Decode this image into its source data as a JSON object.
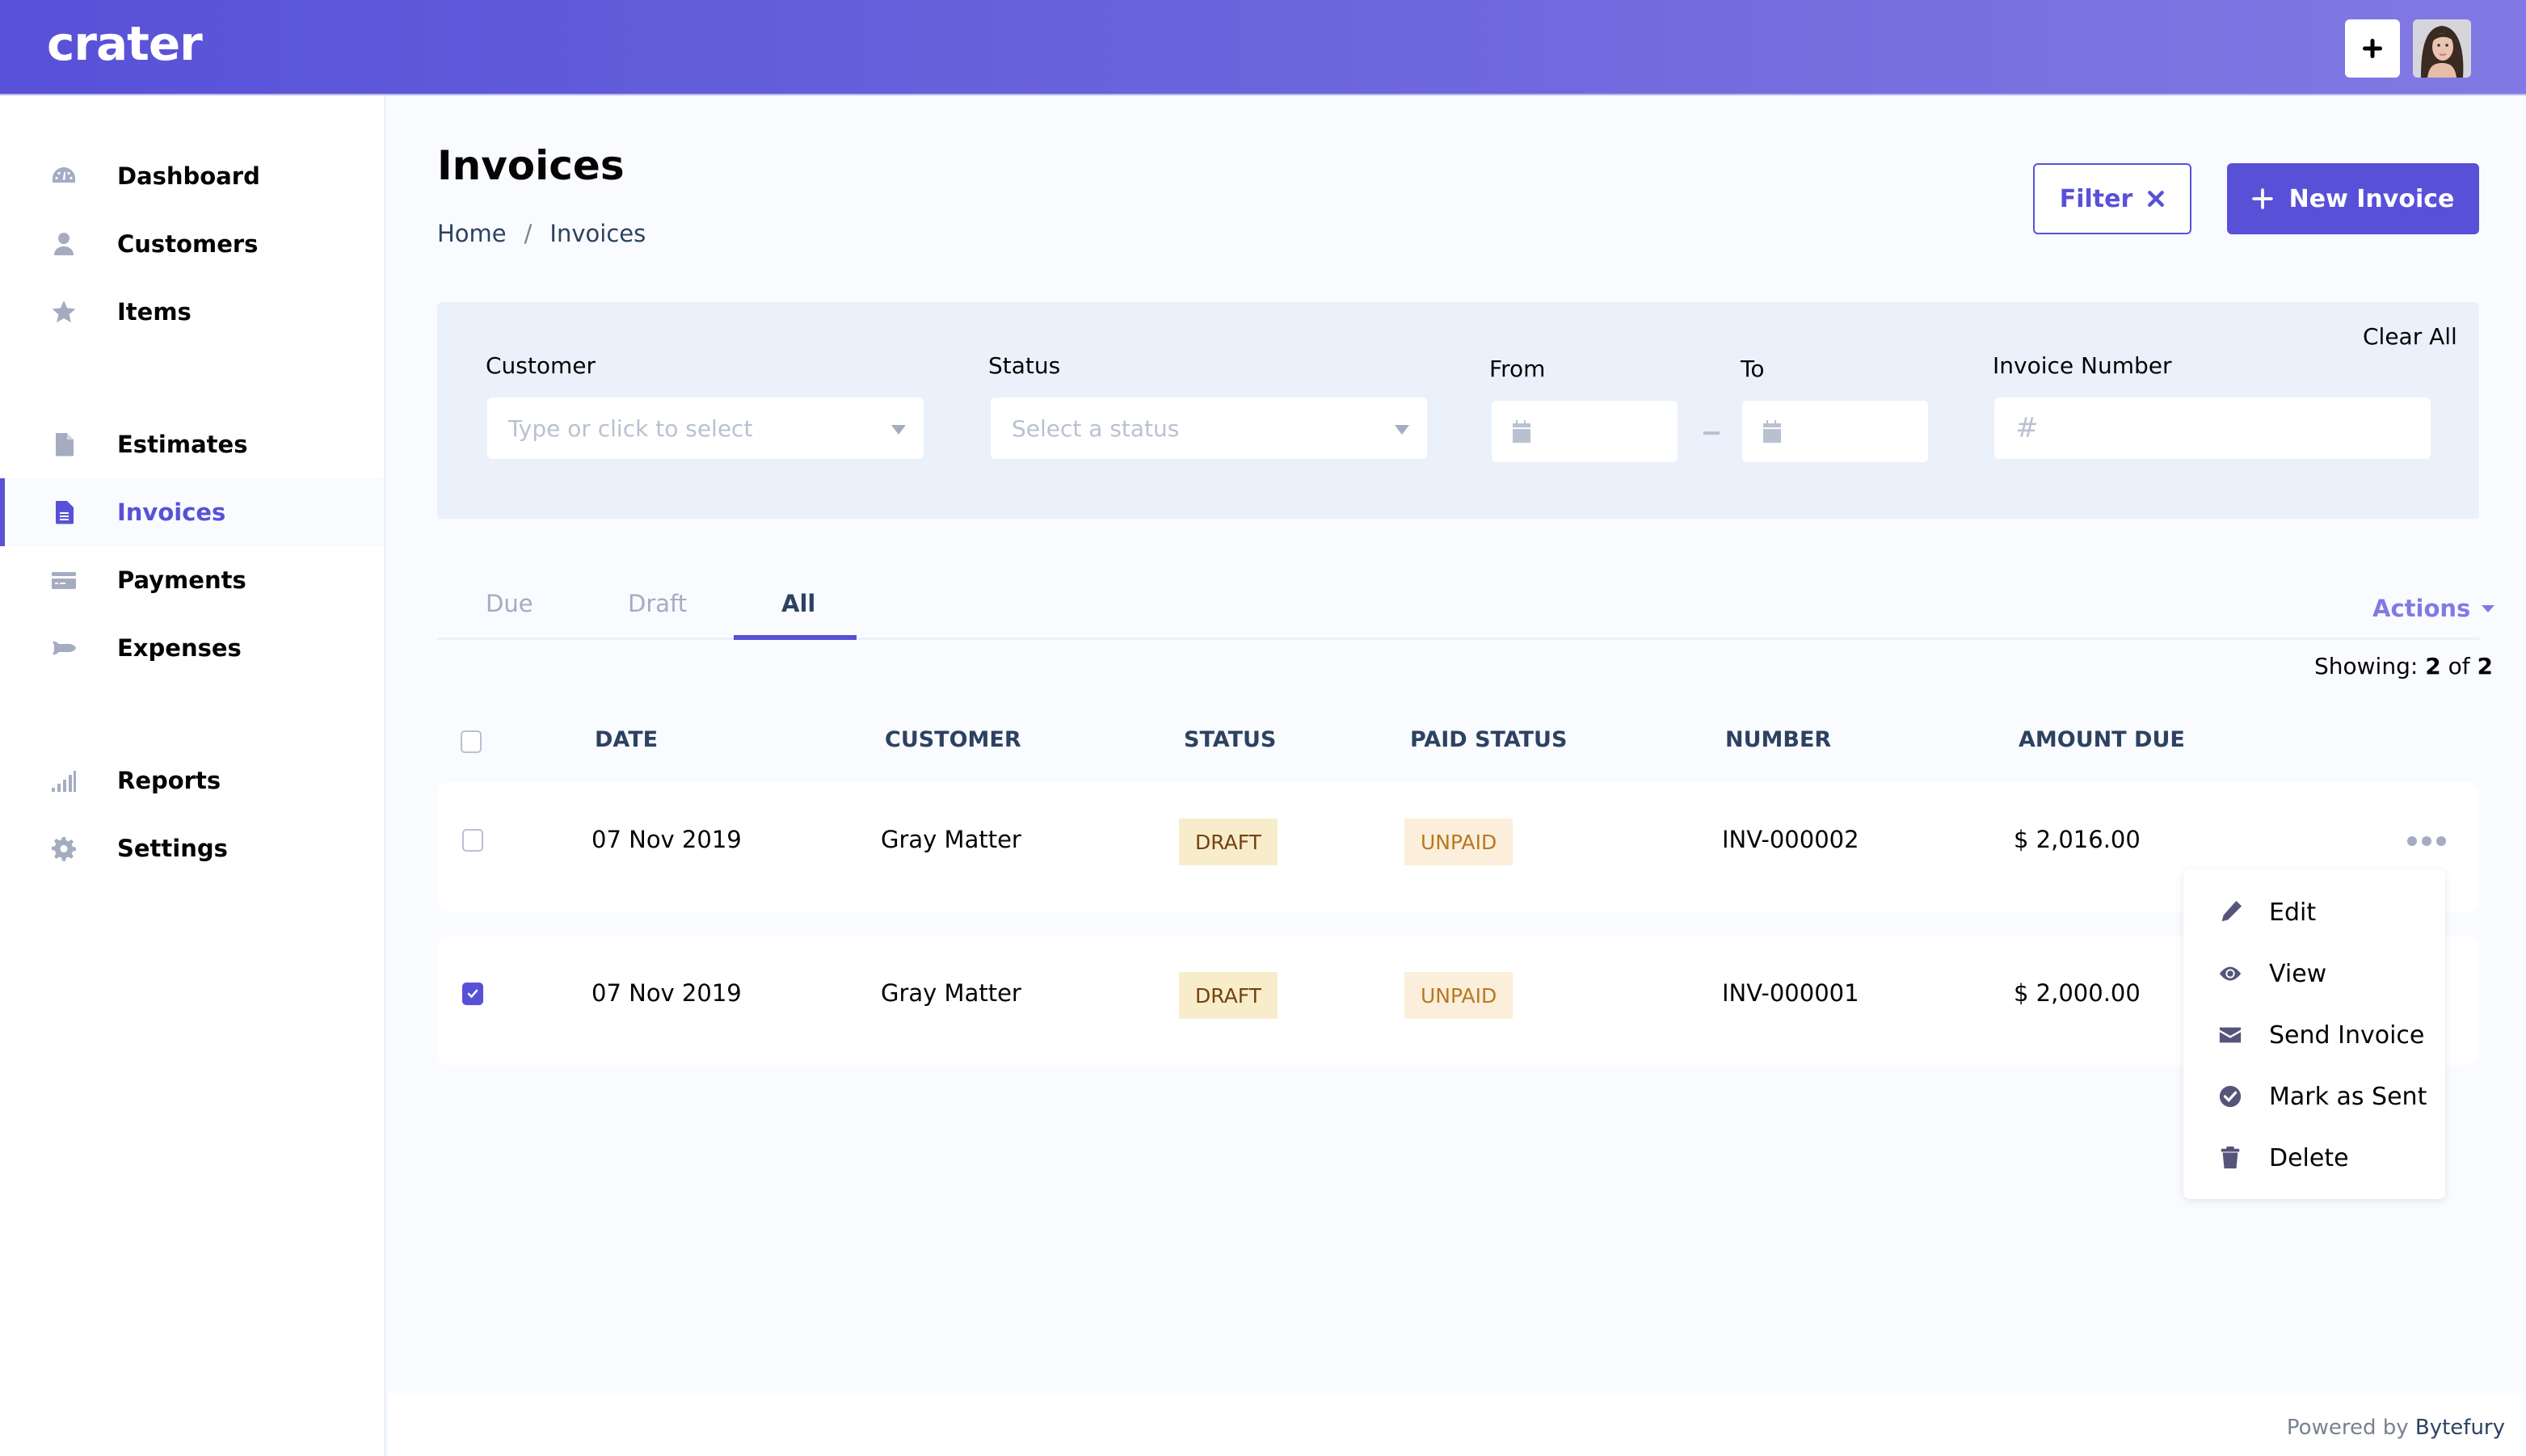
{
  "app": {
    "logo_text": "crater",
    "header_add_icon": "plus-icon",
    "avatar_alt": "user-avatar"
  },
  "sidebar": {
    "items": [
      {
        "label": "Dashboard",
        "icon": "dashboard-gauge-icon",
        "active": false
      },
      {
        "label": "Customers",
        "icon": "user-icon",
        "active": false
      },
      {
        "label": "Items",
        "icon": "star-icon",
        "active": false
      },
      {
        "label": "Estimates",
        "icon": "file-icon",
        "active": false
      },
      {
        "label": "Invoices",
        "icon": "file-text-icon",
        "active": true
      },
      {
        "label": "Payments",
        "icon": "credit-card-icon",
        "active": false
      },
      {
        "label": "Expenses",
        "icon": "space-shuttle-icon",
        "active": false
      },
      {
        "label": "Reports",
        "icon": "signal-bars-icon",
        "active": false
      },
      {
        "label": "Settings",
        "icon": "cog-icon",
        "active": false
      }
    ]
  },
  "page": {
    "title": "Invoices",
    "breadcrumb": [
      {
        "label": "Home"
      },
      {
        "label": "Invoices"
      }
    ],
    "breadcrumb_separator": "/",
    "filter_button": "Filter",
    "new_invoice_button": "New Invoice"
  },
  "filters": {
    "clear_all": "Clear All",
    "customer": {
      "label": "Customer",
      "placeholder": "Type or click to select",
      "value": ""
    },
    "status": {
      "label": "Status",
      "placeholder": "Select a status",
      "value": ""
    },
    "from": {
      "label": "From",
      "value": ""
    },
    "to": {
      "label": "To",
      "value": ""
    },
    "invoice_number": {
      "label": "Invoice Number",
      "prefix": "#",
      "value": ""
    }
  },
  "tabs": {
    "items": [
      {
        "label": "Due",
        "active": false
      },
      {
        "label": "Draft",
        "active": false
      },
      {
        "label": "All",
        "active": true
      }
    ],
    "actions_label": "Actions"
  },
  "table": {
    "showing_prefix": "Showing:",
    "showing_count": "2",
    "showing_of": "of",
    "showing_total": "2",
    "columns": [
      "DATE",
      "CUSTOMER",
      "STATUS",
      "PAID STATUS",
      "NUMBER",
      "AMOUNT DUE"
    ],
    "rows": [
      {
        "checked": false,
        "date": "07 Nov 2019",
        "customer": "Gray Matter",
        "status": "DRAFT",
        "paid_status": "UNPAID",
        "number": "INV-000002",
        "amount_due": "$ 2,016.00"
      },
      {
        "checked": true,
        "date": "07 Nov 2019",
        "customer": "Gray Matter",
        "status": "DRAFT",
        "paid_status": "UNPAID",
        "number": "INV-000001",
        "amount_due": "$ 2,000.00"
      }
    ]
  },
  "row_menu": {
    "items": [
      {
        "label": "Edit",
        "icon": "pencil-icon"
      },
      {
        "label": "View",
        "icon": "eye-icon"
      },
      {
        "label": "Send Invoice",
        "icon": "envelope-icon"
      },
      {
        "label": "Mark as Sent",
        "icon": "check-circle-icon"
      },
      {
        "label": "Delete",
        "icon": "trash-icon"
      }
    ]
  },
  "footer": {
    "powered_by": "Powered by",
    "brand": "Bytefury"
  },
  "colors": {
    "primary": "#5851d8",
    "draft_badge_bg": "#f8edcb",
    "draft_badge_text": "#744210",
    "unpaid_badge_bg": "#fbeedb",
    "unpaid_badge_text": "#b7791f"
  }
}
